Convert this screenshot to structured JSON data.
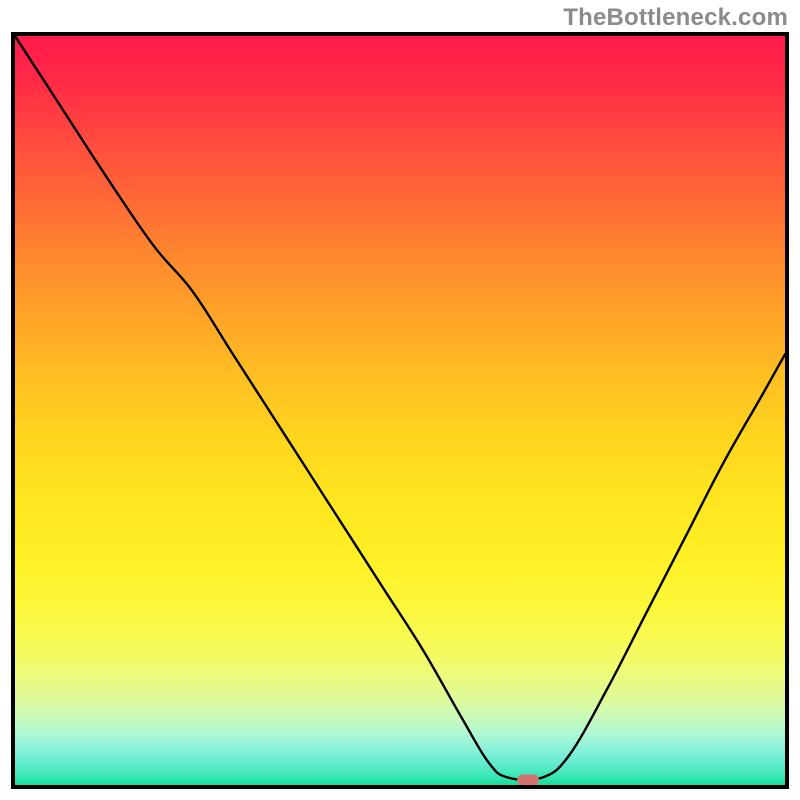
{
  "watermark": "TheBottleneck.com",
  "frame": {
    "inner_w": 770,
    "inner_h": 749
  },
  "marker": {
    "x_frac": 0.666,
    "y_frac": 0.993
  },
  "chart_data": {
    "type": "line",
    "title": "",
    "xlabel": "",
    "ylabel": "",
    "xlim": [
      0,
      1
    ],
    "ylim": [
      0,
      1
    ],
    "note": "Axes are unlabeled; values are fractional positions read from the plot frame (0 = left/bottom, 1 = right/top). The curve is y as a function of x, with a marked minimum.",
    "series": [
      {
        "name": "curve",
        "x": [
          0.0,
          0.06,
          0.12,
          0.18,
          0.23,
          0.28,
          0.33,
          0.38,
          0.43,
          0.48,
          0.53,
          0.58,
          0.615,
          0.64,
          0.685,
          0.72,
          0.77,
          0.82,
          0.87,
          0.92,
          0.97,
          1.0
        ],
        "y": [
          1.0,
          0.905,
          0.81,
          0.72,
          0.66,
          0.58,
          0.5,
          0.42,
          0.34,
          0.26,
          0.18,
          0.09,
          0.03,
          0.01,
          0.01,
          0.04,
          0.13,
          0.23,
          0.33,
          0.43,
          0.52,
          0.575
        ]
      }
    ],
    "annotations": [
      {
        "kind": "marker",
        "x": 0.666,
        "y": 0.007,
        "label": "min"
      }
    ],
    "background": "vertical gradient red→orange→yellow→green"
  }
}
